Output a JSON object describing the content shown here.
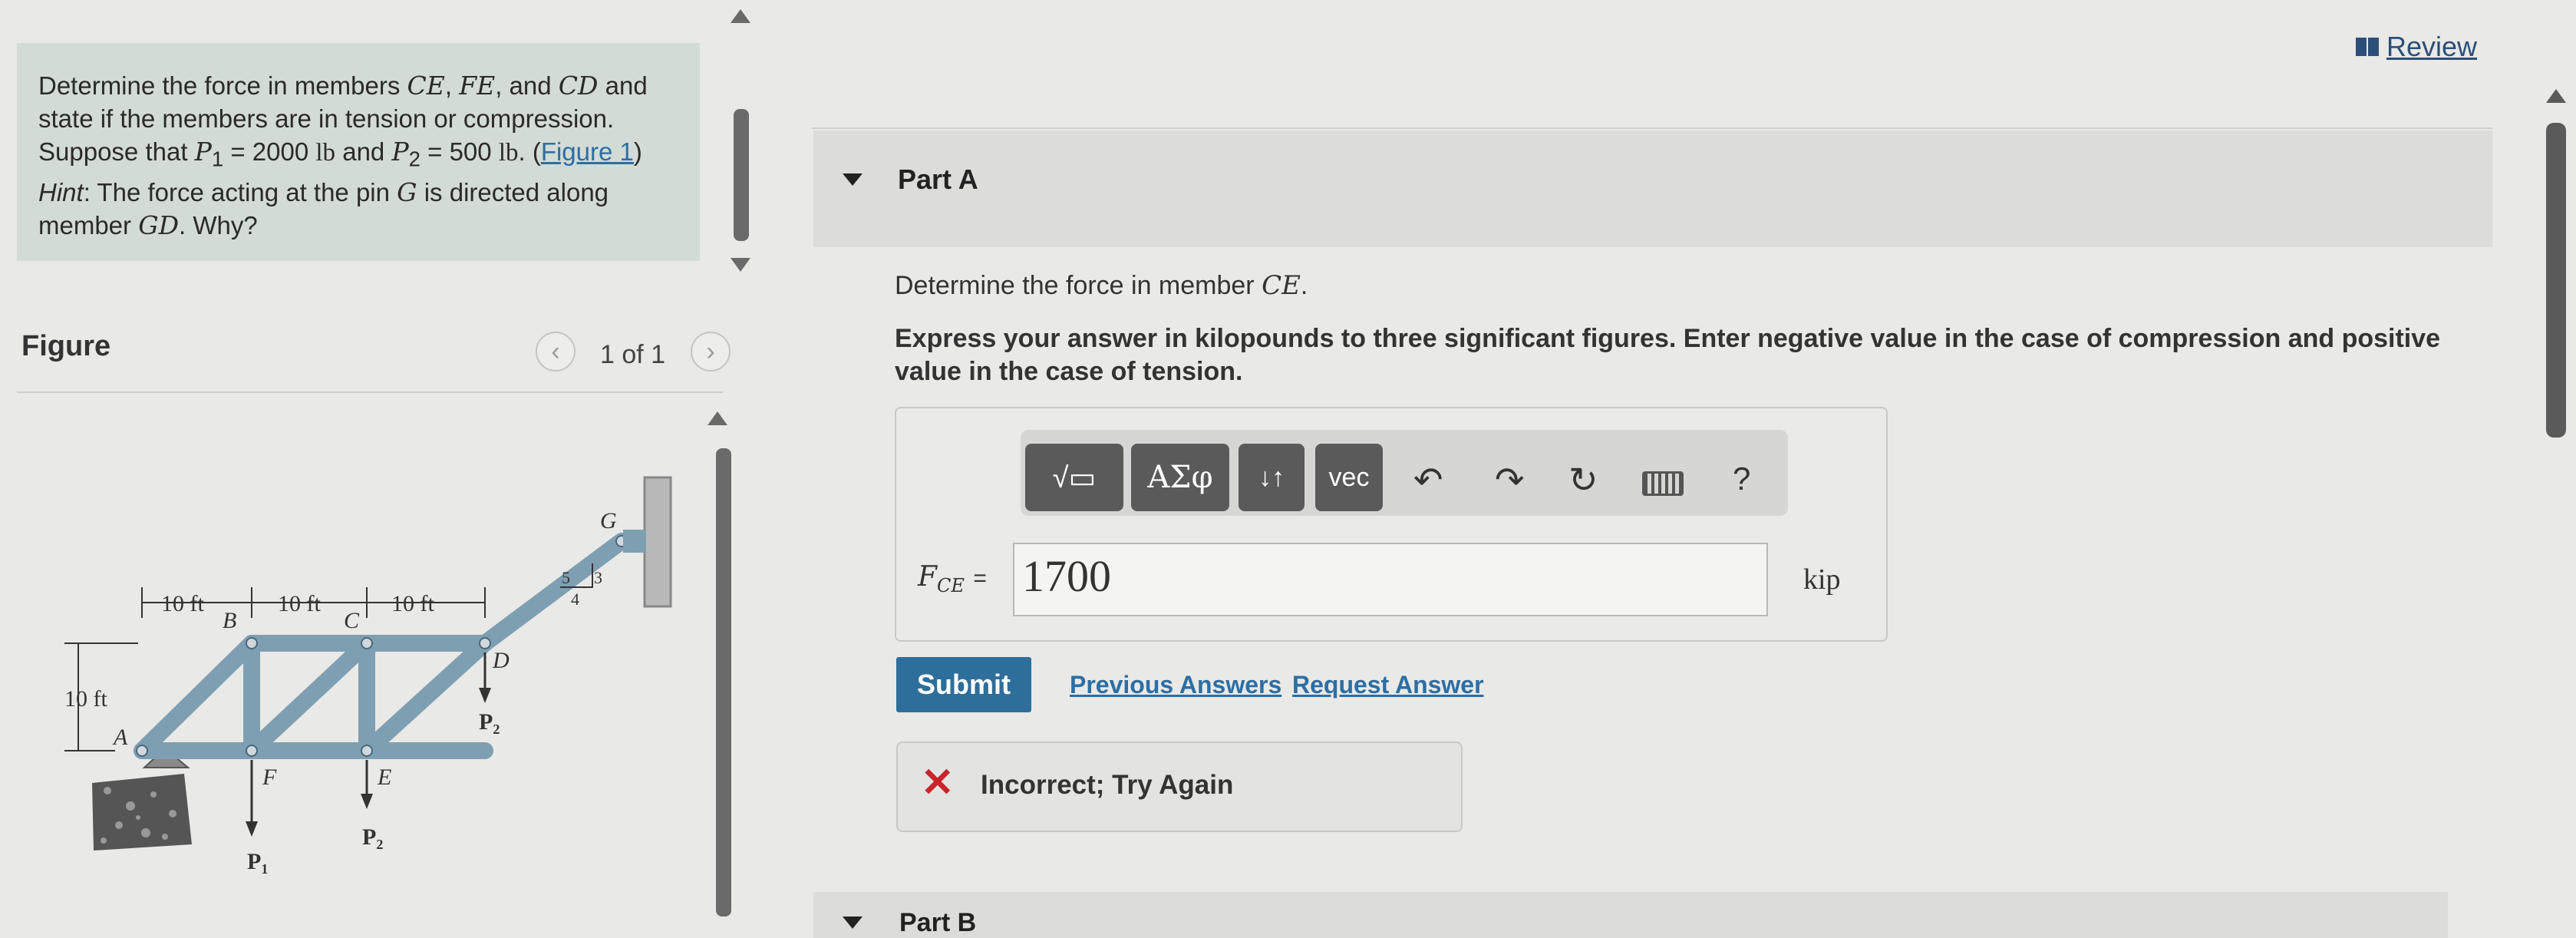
{
  "problem": {
    "t1": "Determine the force in members ",
    "m1": "CE",
    "t2": ", ",
    "m2": "FE",
    "t3": ", and ",
    "m3": "CD",
    "t4": " and state if the members are in tension or compression. Suppose that ",
    "m4": "P",
    "sub4": "1",
    "t5": " = 2000 ",
    "u5": "lb",
    "t6": " and ",
    "m6": "P",
    "sub6": "2",
    "t7": " = 500 ",
    "u7": "lb",
    "t8": ". (",
    "link": "Figure 1",
    "t9": ") ",
    "hint": "Hint",
    "t10": ": The force acting at the pin ",
    "m10": "G",
    "t11": " is directed along member ",
    "m11": "GD",
    "t12": ". Why?"
  },
  "figure": {
    "title": "Figure",
    "pager": "1 of 1",
    "prev_icon": "chevron-left-icon",
    "next_icon": "chevron-right-icon",
    "labels": {
      "dim1": "10 ft",
      "dim2": "10 ft",
      "dim3": "10 ft",
      "height": "10 ft",
      "A": "A",
      "B": "B",
      "C": "C",
      "D": "D",
      "E": "E",
      "F": "F",
      "G": "G",
      "slope_5": "5",
      "slope_3": "3",
      "slope_4": "4",
      "P1": "P",
      "P1_sub": "1",
      "P2a": "P",
      "P2a_sub": "2",
      "P2b": "P",
      "P2b_sub": "2"
    }
  },
  "review": {
    "label": "Review",
    "icon": "book-icon"
  },
  "partA": {
    "label": "Part A",
    "question_text": "Determine the force in member ",
    "question_member": "CE",
    "question_end": ".",
    "instructions": "Express your answer in kilopounds to three significant figures. Enter negative value in the case of compression and positive value in the case of tension.",
    "toolbar": {
      "templates": "√▭",
      "greek": "ΑΣφ",
      "arrows": "↓↑",
      "vec": "vec",
      "undo_icon": "undo-icon",
      "redo_icon": "redo-icon",
      "reset_icon": "reset-icon",
      "keyboard_icon": "keyboard-icon",
      "help": "?"
    },
    "input_label_main": "F",
    "input_label_sub": "CE",
    "input_label_eq": "=",
    "input_value": "1700",
    "unit": "kip",
    "submit": "Submit",
    "previous_answers": "Previous Answers",
    "request_answer": "Request Answer",
    "feedback": "Incorrect; Try Again",
    "feedback_icon": "x-icon"
  },
  "partB": {
    "label": "Part B"
  },
  "colors": {
    "accent": "#2e6e9a",
    "error": "#c8242b",
    "problem_bg": "#d3dbd6",
    "truss": "#7e9fb2"
  }
}
